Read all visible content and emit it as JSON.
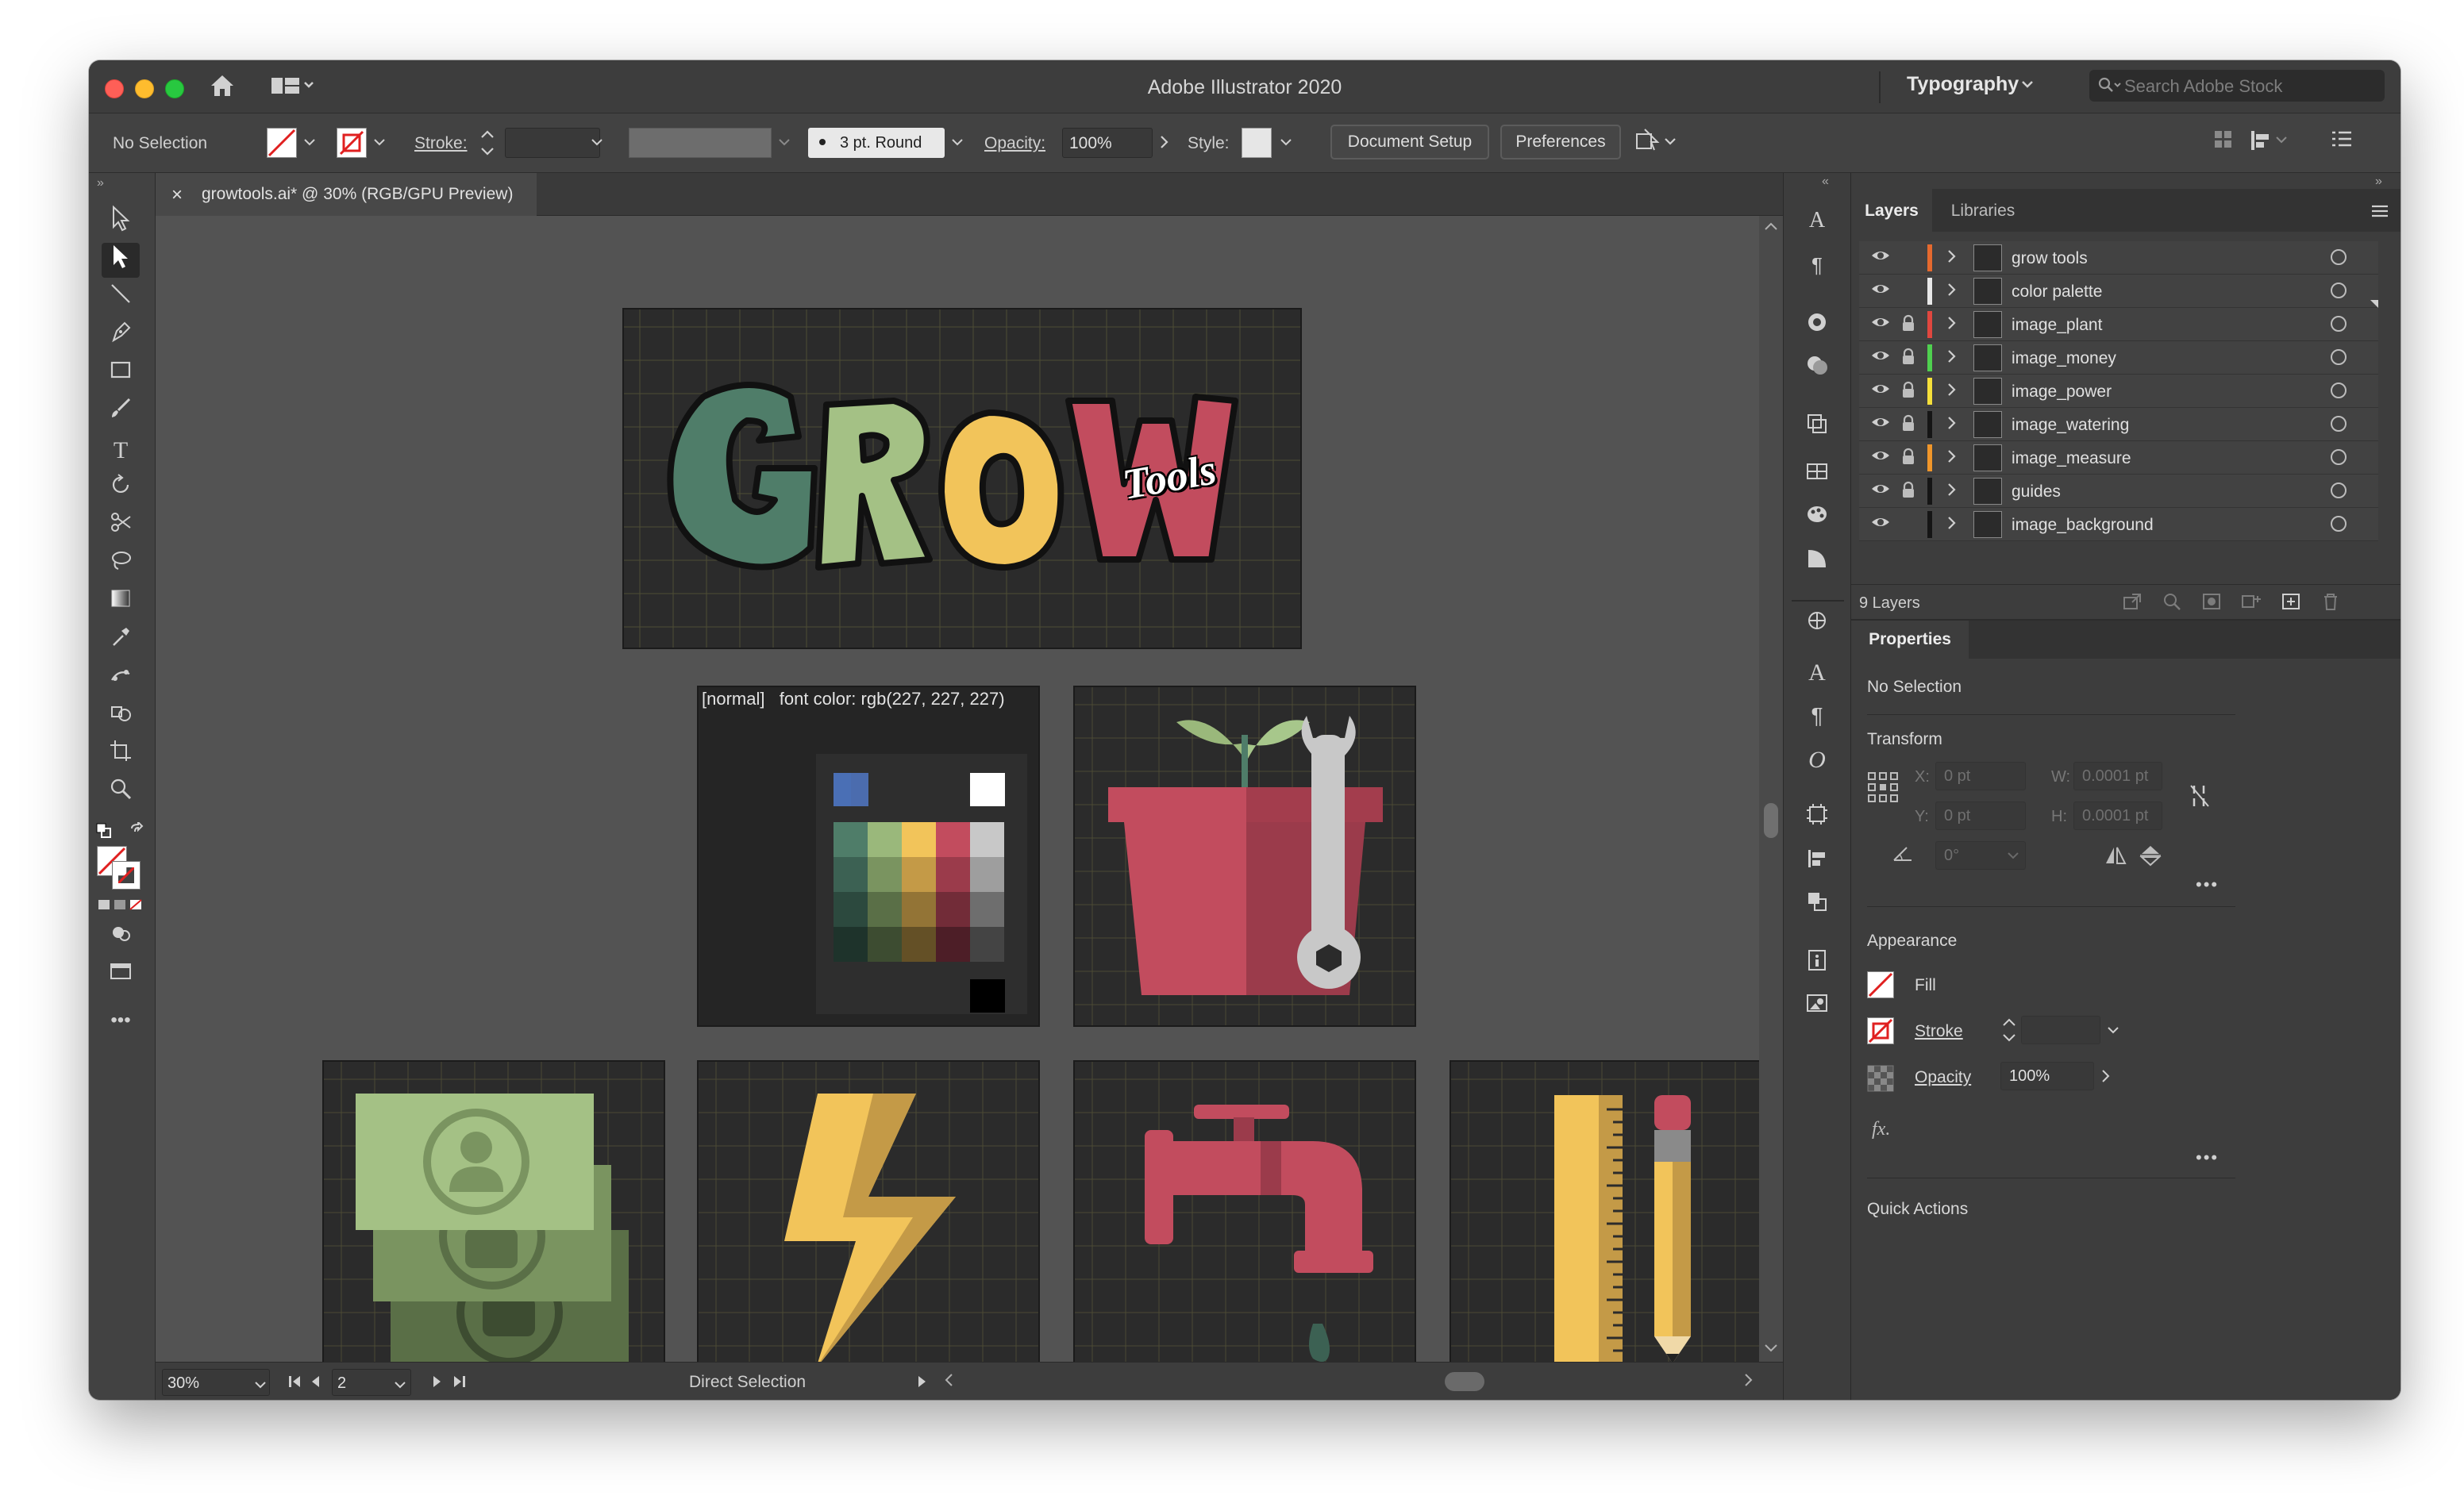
{
  "app": {
    "title": "Adobe Illustrator 2020",
    "workspace": "Typography",
    "stock_placeholder": "Search Adobe Stock"
  },
  "controlbar": {
    "selection": "No Selection",
    "stroke_label": "Stroke:",
    "brush": "3 pt. Round",
    "opacity_label": "Opacity:",
    "opacity_value": "100%",
    "style_label": "Style:",
    "document_setup": "Document Setup",
    "preferences": "Preferences"
  },
  "document": {
    "tab": "growtools.ai* @ 30% (RGB/GPU Preview)"
  },
  "canvas": {
    "artboard_label": "[normal]   font color: rgb(227, 227, 227)",
    "logo_word": "GROW",
    "logo_sub": "Tools",
    "palette": {
      "top_left": [
        "#4a6fb5",
        "#4b6cae"
      ],
      "top_right": "#ffffff",
      "rows": [
        [
          "#4f7d69",
          "#9ab87b",
          "#f2c45a",
          "#c24c5e",
          "#c8c8c8"
        ],
        [
          "#3c6153",
          "#7a9460",
          "#c49a47",
          "#9b3b4b",
          "#9e9e9e"
        ],
        [
          "#2c493e",
          "#5a6f47",
          "#937436",
          "#722c38",
          "#6e6e6e"
        ],
        [
          "#1e332b",
          "#3d4c31",
          "#645026",
          "#4d1e27",
          "#444444"
        ]
      ],
      "bottom_right": "#000000"
    }
  },
  "statusbar": {
    "zoom": "30%",
    "artboard_num": "2",
    "tool": "Direct Selection"
  },
  "layers_panel": {
    "tabs": [
      "Layers",
      "Libraries"
    ],
    "layers": [
      {
        "name": "grow tools",
        "color": "#e5692e",
        "locked": false
      },
      {
        "name": "color palette",
        "color": "#e8e8e8",
        "locked": false
      },
      {
        "name": "image_plant",
        "color": "#e0473f",
        "locked": true
      },
      {
        "name": "image_money",
        "color": "#4fd04f",
        "locked": true
      },
      {
        "name": "image_power",
        "color": "#f5df3a",
        "locked": true
      },
      {
        "name": "image_watering",
        "color": "#151515",
        "locked": true
      },
      {
        "name": "image_measure",
        "color": "#f0962a",
        "locked": true
      },
      {
        "name": "guides",
        "color": "#151515",
        "locked": true
      },
      {
        "name": "image_background",
        "color": "#151515",
        "locked": false
      }
    ],
    "count": "9 Layers"
  },
  "properties_panel": {
    "title": "Properties",
    "selection": "No Selection",
    "transform": {
      "title": "Transform",
      "x_label": "X:",
      "x_value": "0 pt",
      "y_label": "Y:",
      "y_value": "0 pt",
      "w_label": "W:",
      "w_value": "0.0001 pt",
      "h_label": "H:",
      "h_value": "0.0001 pt",
      "angle_value": "0°"
    },
    "appearance": {
      "title": "Appearance",
      "fill": "Fill",
      "stroke": "Stroke",
      "opacity_label": "Opacity",
      "opacity_value": "100%",
      "fx": "fx."
    },
    "quick_actions": "Quick Actions"
  }
}
